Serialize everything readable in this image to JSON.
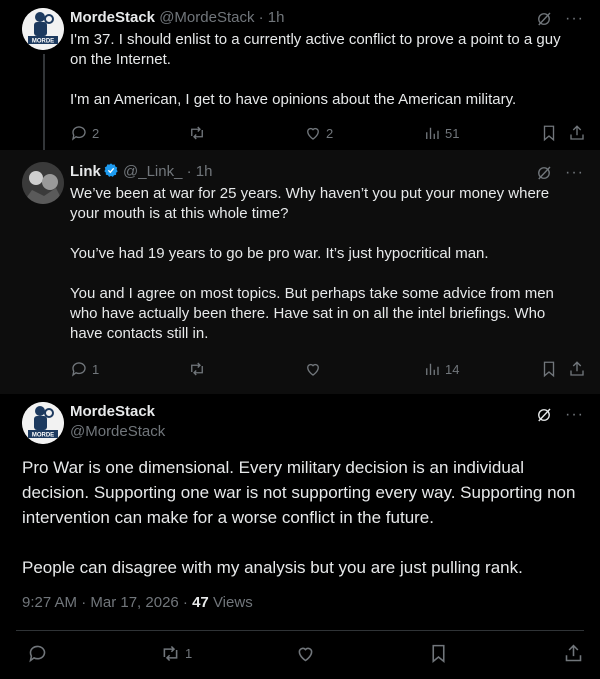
{
  "tweets": [
    {
      "name": "MordeStack",
      "handle": "@MordeStack",
      "time": "· 1h",
      "paragraphs": [
        "I'm 37. I should enlist to a currently active conflict to prove a point to a guy on the Internet.",
        "I'm an American, I get to have opinions about the American military."
      ],
      "replies": "2",
      "reposts": "",
      "likes": "2",
      "views": "51"
    },
    {
      "name": "Link",
      "handle": "@_Link_",
      "time": "· 1h",
      "paragraphs": [
        "We’ve been at war for 25 years. Why haven’t you put your money where your mouth is at this whole time?",
        "You’ve had 19 years to go be pro war. It’s just hypocritical man.",
        "You and I agree on most topics. But perhaps take some advice from men who have actually been there. Have sat in on all the intel briefings. Who have contacts still in."
      ],
      "replies": "1",
      "reposts": "",
      "likes": "",
      "views": "14"
    }
  ],
  "main": {
    "name": "MordeStack",
    "handle": "@MordeStack",
    "paragraphs": [
      "Pro War is one dimensional. Every military decision is an individual decision. Supporting one war is not supporting every way. Supporting non intervention can make for a worse conflict in the future.",
      "People can disagree with my analysis but you are just pulling rank."
    ],
    "timestamp": "9:27 AM · Mar 17, 2026 · ",
    "views_count": "47",
    "views_label": " Views",
    "reposts": "1"
  },
  "icons": {
    "more": "more-icon",
    "grok": "grok-icon",
    "reply": "reply-icon",
    "repost": "repost-icon",
    "like": "like-icon",
    "views": "views-icon",
    "bookmark": "bookmark-icon",
    "share": "share-icon",
    "verified": "verified-badge-icon"
  },
  "colors": {
    "background": "#000000",
    "text": "#e7e9ea",
    "muted": "#71767b",
    "verified": "#1d9bf0"
  }
}
